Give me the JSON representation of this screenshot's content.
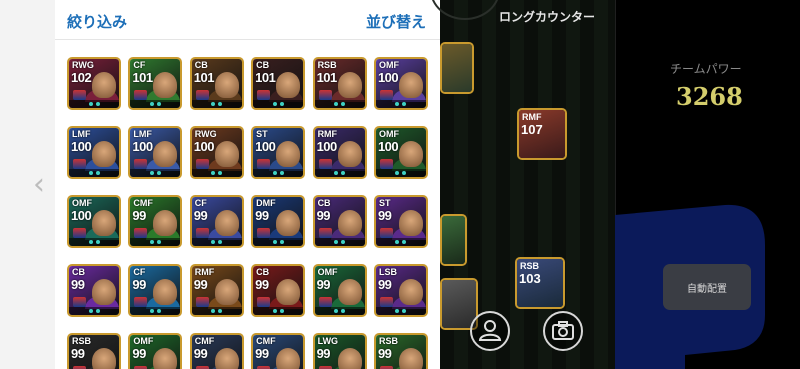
{
  "header": {
    "filter_label": "絞り込み",
    "sort_label": "並び替え"
  },
  "pitch": {
    "title": "ロングカウンター"
  },
  "team": {
    "power_label": "チームパワー",
    "power_value": "3268",
    "auto_button": "自動配置"
  },
  "colors": {
    "link": "#1d6fb8",
    "power": "#d4cd6c"
  },
  "cards": [
    {
      "pos": "RWG",
      "rating": "102",
      "theme": "#7a1f3a"
    },
    {
      "pos": "CF",
      "rating": "101",
      "theme": "#2f7a2f"
    },
    {
      "pos": "CB",
      "rating": "101",
      "theme": "#5a3a1c"
    },
    {
      "pos": "CB",
      "rating": "101",
      "theme": "#3a1f1f"
    },
    {
      "pos": "RSB",
      "rating": "101",
      "theme": "#6a2a2a"
    },
    {
      "pos": "OMF",
      "rating": "100",
      "theme": "#5a3fa0"
    },
    {
      "pos": "LMF",
      "rating": "100",
      "theme": "#2c4f9c"
    },
    {
      "pos": "LMF",
      "rating": "100",
      "theme": "#3a5aa8"
    },
    {
      "pos": "RWG",
      "rating": "100",
      "theme": "#6e3a1e"
    },
    {
      "pos": "ST",
      "rating": "100",
      "theme": "#2a4a8a"
    },
    {
      "pos": "RMF",
      "rating": "100",
      "theme": "#3a2a6a"
    },
    {
      "pos": "OMF",
      "rating": "100",
      "theme": "#1e5a2a"
    },
    {
      "pos": "OMF",
      "rating": "100",
      "theme": "#1a6a5a"
    },
    {
      "pos": "CMF",
      "rating": "99",
      "theme": "#2a7a2a"
    },
    {
      "pos": "CF",
      "rating": "99",
      "theme": "#3a4aa0"
    },
    {
      "pos": "DMF",
      "rating": "99",
      "theme": "#1a3a7a"
    },
    {
      "pos": "CB",
      "rating": "99",
      "theme": "#4a2a7a"
    },
    {
      "pos": "ST",
      "rating": "99",
      "theme": "#5a2a8a"
    },
    {
      "pos": "CB",
      "rating": "99",
      "theme": "#6a2aa0"
    },
    {
      "pos": "CF",
      "rating": "99",
      "theme": "#1a6aa0"
    },
    {
      "pos": "RMF",
      "rating": "99",
      "theme": "#7a4a1a"
    },
    {
      "pos": "CB",
      "rating": "99",
      "theme": "#7a1a1a"
    },
    {
      "pos": "OMF",
      "rating": "99",
      "theme": "#1a6a3a"
    },
    {
      "pos": "LSB",
      "rating": "99",
      "theme": "#5a2a8a"
    },
    {
      "pos": "RSB",
      "rating": "99",
      "theme": "#2a2a2a"
    },
    {
      "pos": "OMF",
      "rating": "99",
      "theme": "#1e6a2a"
    },
    {
      "pos": "CMF",
      "rating": "99",
      "theme": "#2a3a5a"
    },
    {
      "pos": "CMF",
      "rating": "99",
      "theme": "#2a4a7a"
    },
    {
      "pos": "LWG",
      "rating": "99",
      "theme": "#1a5a2a"
    },
    {
      "pos": "RSB",
      "rating": "99",
      "theme": "#2a6a2a"
    }
  ],
  "pitch_cards": [
    {
      "pos": "RMF",
      "rating": "107"
    },
    {
      "pos": "RSB",
      "rating": "103"
    }
  ]
}
